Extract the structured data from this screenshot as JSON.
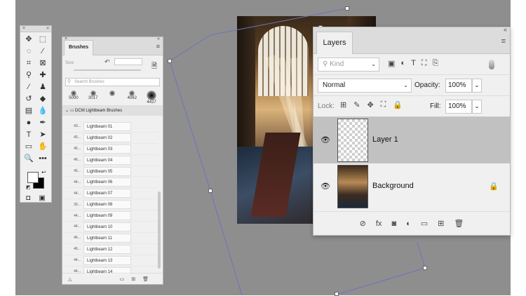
{
  "tools_panel": {
    "close_glyph": "×",
    "collapse_glyph": "«",
    "tools": [
      {
        "name": "move-tool-icon",
        "glyph": "✥"
      },
      {
        "name": "marquee-tool-icon",
        "glyph": "⬚"
      },
      {
        "name": "lasso-tool-icon",
        "glyph": "◌"
      },
      {
        "name": "quick-select-tool-icon",
        "glyph": "⁄"
      },
      {
        "name": "crop-tool-icon",
        "glyph": "⌗"
      },
      {
        "name": "frame-tool-icon",
        "glyph": "⊠"
      },
      {
        "name": "eyedropper-tool-icon",
        "glyph": "⚲"
      },
      {
        "name": "healing-brush-tool-icon",
        "glyph": "✚"
      },
      {
        "name": "brush-tool-icon",
        "glyph": "∕"
      },
      {
        "name": "stamp-tool-icon",
        "glyph": "♟"
      },
      {
        "name": "history-brush-tool-icon",
        "glyph": "↺"
      },
      {
        "name": "eraser-tool-icon",
        "glyph": "◆"
      },
      {
        "name": "gradient-tool-icon",
        "glyph": "▤"
      },
      {
        "name": "blur-tool-icon",
        "glyph": "💧"
      },
      {
        "name": "dodge-tool-icon",
        "glyph": "●"
      },
      {
        "name": "pen-tool-icon",
        "glyph": "✒"
      },
      {
        "name": "type-tool-icon",
        "glyph": "T"
      },
      {
        "name": "path-select-tool-icon",
        "glyph": "➤"
      },
      {
        "name": "shape-tool-icon",
        "glyph": "▭"
      },
      {
        "name": "hand-tool-icon",
        "glyph": "✋"
      },
      {
        "name": "zoom-tool-icon",
        "glyph": "🔍"
      },
      {
        "name": "more-tools-icon",
        "glyph": "•••"
      }
    ],
    "swap_colors_glyph": "↩",
    "default_colors_glyph": "◩",
    "quick_mask_glyph": "◘",
    "screen_mode_glyph": "▣"
  },
  "brushes_panel": {
    "tab_label": "Brushes",
    "collapse_glyph": "«",
    "close_glyph": "×",
    "menu_glyph": "≡",
    "size_label": "Size:",
    "reset_glyph": "↶",
    "new_brush_glyph": "🗎",
    "search_placeholder": "Search Brushes",
    "search_glyph": "⚲",
    "recent_brushes": [
      "5000",
      "3017",
      "",
      "4062",
      "4427"
    ],
    "group_name": "DCM Lightbeam Brushes",
    "group_glyph": "⌄ ▭",
    "brushes": [
      {
        "size": "43...",
        "name": "Lightbeam 01"
      },
      {
        "size": "45...",
        "name": "Lightbeam 02"
      },
      {
        "size": "46...",
        "name": "Lightbeam 03"
      },
      {
        "size": "46...",
        "name": "Lightbeam 04"
      },
      {
        "size": "45...",
        "name": "Lightbeam 05"
      },
      {
        "size": "44...",
        "name": "Lightbeam 06"
      },
      {
        "size": "44...",
        "name": "Lightbeam 07"
      },
      {
        "size": "39...",
        "name": "Lightbeam 08"
      },
      {
        "size": "44...",
        "name": "Lightbeam 09"
      },
      {
        "size": "44...",
        "name": "Lightbeam 10"
      },
      {
        "size": "46...",
        "name": "Lightbeam 11"
      },
      {
        "size": "46...",
        "name": "Lightbeam 12"
      },
      {
        "size": "44...",
        "name": "Lightbeam 13"
      },
      {
        "size": "44...",
        "name": "Lightbeam 14"
      }
    ],
    "footer": {
      "left_glyph": "△",
      "folder_glyph": "▭",
      "add_glyph": "⊞",
      "trash_glyph": "🗑"
    }
  },
  "layers_panel": {
    "tab_label": "Layers",
    "collapse_glyph": "«",
    "menu_glyph": "≡",
    "filter": {
      "kind_label": "Kind",
      "search_glyph": "⚲",
      "icons": [
        "▣",
        "◐",
        "T",
        "⛶",
        "⎘"
      ]
    },
    "blend_mode": "Normal",
    "opacity_label": "Opacity:",
    "opacity_value": "100%",
    "lock_label": "Lock:",
    "lock_icons": [
      "⊞",
      "✎",
      "✥",
      "⛶",
      "🔒"
    ],
    "fill_label": "Fill:",
    "fill_value": "100%",
    "layers": [
      {
        "name": "Layer 1",
        "selected": true,
        "locked": false
      },
      {
        "name": "Background",
        "selected": false,
        "locked": true
      }
    ],
    "eye_glyph": "👁",
    "lock_glyph": "🔒",
    "footer_icons": [
      "⊘",
      "fx",
      "◙",
      "◐",
      "▭",
      "⊞",
      "🗑"
    ]
  },
  "colors": {
    "canvas_bg": "#8e8e8e",
    "panel_bg": "#f0f0f0",
    "selected_layer": "#c1c1c1",
    "transform_line": "#6e74b8"
  }
}
